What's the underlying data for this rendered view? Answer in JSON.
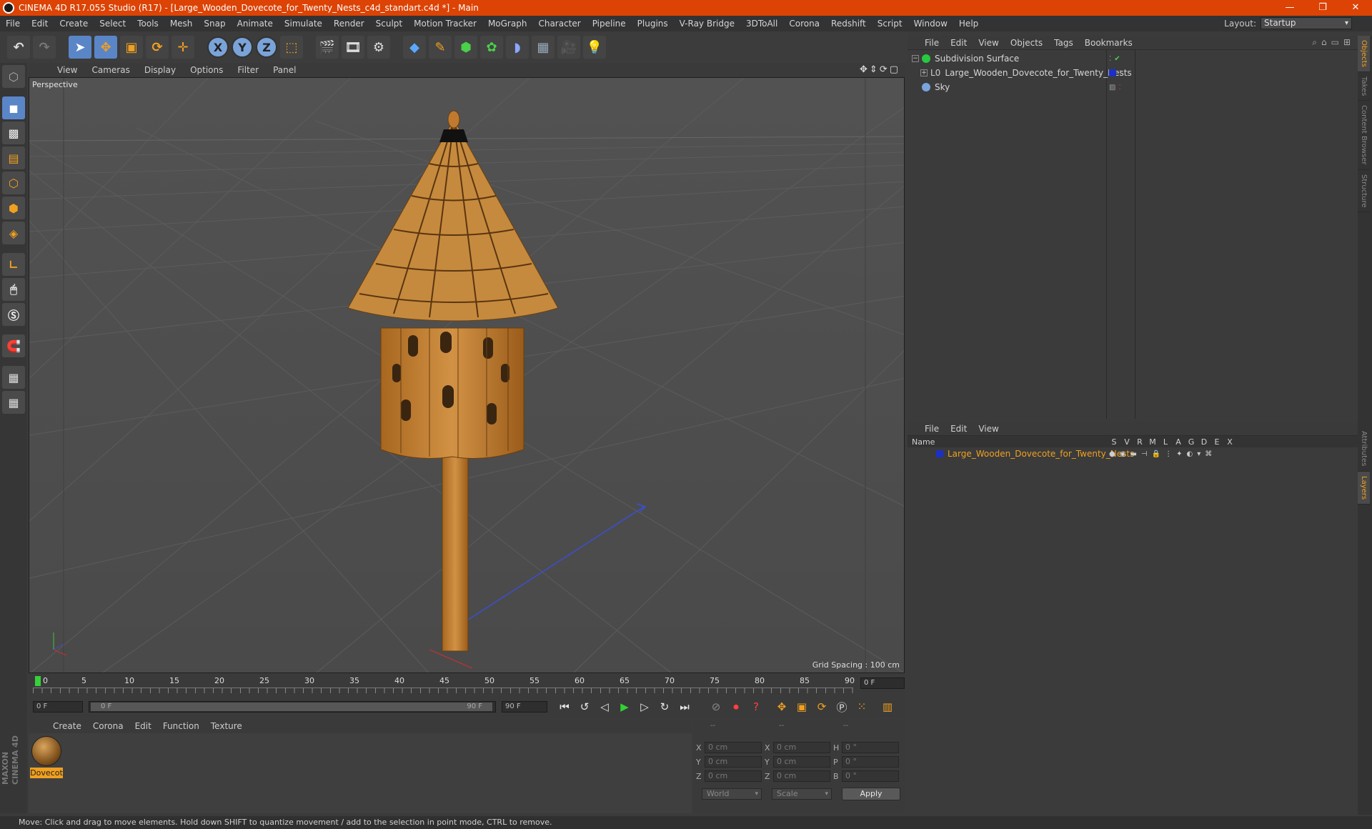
{
  "window": {
    "title": "CINEMA 4D R17.055 Studio (R17) - [Large_Wooden_Dovecote_for_Twenty_Nests_c4d_standart.c4d *] - Main",
    "minimize": "—",
    "maximize": "❐",
    "close": "✕"
  },
  "menu": [
    "File",
    "Edit",
    "Create",
    "Select",
    "Tools",
    "Mesh",
    "Snap",
    "Animate",
    "Simulate",
    "Render",
    "Sculpt",
    "Motion Tracker",
    "MoGraph",
    "Character",
    "Pipeline",
    "Plugins",
    "V-Ray Bridge",
    "3DToAll",
    "Corona",
    "Redshift",
    "Script",
    "Window",
    "Help"
  ],
  "layout": {
    "label": "Layout:",
    "value": "Startup"
  },
  "toolbar": {
    "x": "X",
    "y": "Y",
    "z": "Z"
  },
  "viewport": {
    "menu": [
      "View",
      "Cameras",
      "Display",
      "Options",
      "Filter",
      "Panel"
    ],
    "camera": "Perspective",
    "grid_spacing": "Grid Spacing : 100 cm"
  },
  "timeline": {
    "ticks": [
      "0",
      "5",
      "10",
      "15",
      "20",
      "25",
      "30",
      "35",
      "40",
      "45",
      "50",
      "55",
      "60",
      "65",
      "70",
      "75",
      "80",
      "85",
      "90"
    ],
    "current_frame": "0 F",
    "start_field": "0 F",
    "range_start": "0 F",
    "range_end": "90 F",
    "end_field": "90 F"
  },
  "material_manager": {
    "menu": [
      "Create",
      "Corona",
      "Edit",
      "Function",
      "Texture"
    ],
    "materials": [
      {
        "name": "Dovecot"
      }
    ]
  },
  "coordinates": {
    "headers": [
      "--",
      "--",
      "--"
    ],
    "rows": [
      {
        "a1": "X",
        "v1": "0 cm",
        "a2": "X",
        "v2": "0 cm",
        "a3": "H",
        "v3": "0 °"
      },
      {
        "a1": "Y",
        "v1": "0 cm",
        "a2": "Y",
        "v2": "0 cm",
        "a3": "P",
        "v3": "0 °"
      },
      {
        "a1": "Z",
        "v1": "0 cm",
        "a2": "Z",
        "v2": "0 cm",
        "a3": "B",
        "v3": "0 °"
      }
    ],
    "space": "World",
    "mode": "Scale",
    "apply": "Apply"
  },
  "object_manager": {
    "menu": [
      "File",
      "Edit",
      "View",
      "Objects",
      "Tags",
      "Bookmarks"
    ],
    "objects": [
      {
        "name": "Subdivision Surface",
        "color": "#27c93f"
      },
      {
        "name": "Large_Wooden_Dovecote_for_Twenty_Nests",
        "color": "#1c2fc7"
      },
      {
        "name": "Sky",
        "color": "#7aa3d9"
      }
    ]
  },
  "layer_manager": {
    "menu": [
      "File",
      "Edit",
      "View"
    ],
    "name_header": "Name",
    "columns": [
      "S",
      "V",
      "R",
      "M",
      "L",
      "A",
      "G",
      "D",
      "E",
      "X"
    ],
    "layers": [
      {
        "name": "Large_Wooden_Dovecote_for_Twenty_Nests",
        "color": "#1c2fc7"
      }
    ]
  },
  "side_tabs": [
    "Objects",
    "Takes",
    "Content Browser",
    "Structure",
    "Attributes",
    "Layers"
  ],
  "branding": "MAXON CINEMA 4D",
  "status": "Move: Click and drag to move elements. Hold down SHIFT to quantize movement / add to the selection in point mode, CTRL to remove."
}
